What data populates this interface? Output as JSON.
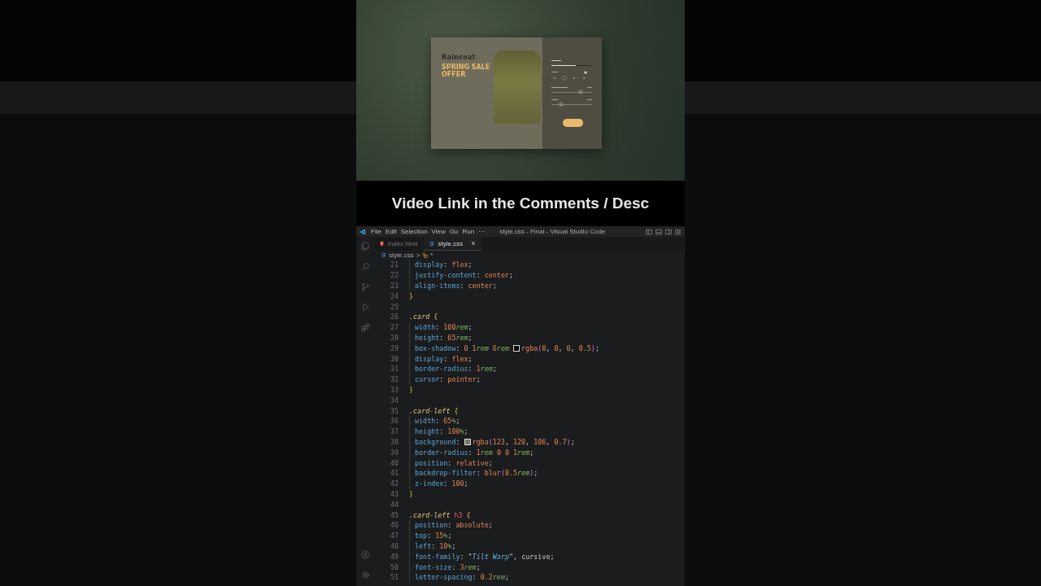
{
  "preview": {
    "card": {
      "eyebrow": "Raincoat",
      "headline": "SPRING SALE OFFER"
    }
  },
  "caption": "Video Link in the Comments / Desc",
  "editor": {
    "menu": [
      "File",
      "Edit",
      "Selection",
      "View",
      "Go",
      "Run",
      "···"
    ],
    "title": "style.css - Final - Visual Studio Code",
    "tabs": [
      {
        "label": "index.html",
        "kind": "html",
        "selected": false
      },
      {
        "label": "style.css",
        "kind": "css",
        "selected": true,
        "close": "×"
      }
    ],
    "breadcrumb": {
      "file": "style.css",
      "separator": ">",
      "symbol": "*"
    },
    "lines": [
      {
        "number": "21",
        "kind": "decl",
        "tokens": [
          {
            "kind": "prop",
            "text": "display"
          },
          {
            "kind": "punct",
            "text": ": "
          },
          {
            "kind": "val",
            "text": "flex"
          },
          {
            "kind": "punct",
            "text": ";"
          }
        ]
      },
      {
        "number": "22",
        "kind": "decl",
        "tokens": [
          {
            "kind": "prop",
            "text": "justify-content"
          },
          {
            "kind": "punct",
            "text": ": "
          },
          {
            "kind": "val",
            "text": "center"
          },
          {
            "kind": "punct",
            "text": ";"
          }
        ]
      },
      {
        "number": "23",
        "kind": "decl",
        "tokens": [
          {
            "kind": "prop",
            "text": "align-items"
          },
          {
            "kind": "punct",
            "text": ": "
          },
          {
            "kind": "val",
            "text": "center"
          },
          {
            "kind": "punct",
            "text": ";"
          }
        ]
      },
      {
        "number": "24",
        "kind": "rule",
        "tokens": [
          {
            "kind": "brace",
            "text": "}"
          }
        ]
      },
      {
        "number": "25",
        "kind": "blank"
      },
      {
        "number": "26",
        "kind": "rule",
        "tokens": [
          {
            "kind": "sel",
            "text": ".card "
          },
          {
            "kind": "brace",
            "text": "{"
          }
        ]
      },
      {
        "number": "27",
        "kind": "decl",
        "tokens": [
          {
            "kind": "prop",
            "text": "width"
          },
          {
            "kind": "punct",
            "text": ": "
          },
          {
            "kind": "val",
            "text": "100"
          },
          {
            "kind": "unit",
            "text": "rem"
          },
          {
            "kind": "punct",
            "text": ";"
          }
        ]
      },
      {
        "number": "28",
        "kind": "decl",
        "tokens": [
          {
            "kind": "prop",
            "text": "height"
          },
          {
            "kind": "punct",
            "text": ": "
          },
          {
            "kind": "val",
            "text": "65"
          },
          {
            "kind": "unit",
            "text": "rem"
          },
          {
            "kind": "punct",
            "text": ";"
          }
        ]
      },
      {
        "number": "29",
        "kind": "decl",
        "tokens": [
          {
            "kind": "prop",
            "text": "box-shadow"
          },
          {
            "kind": "punct",
            "text": ": "
          },
          {
            "kind": "val",
            "text": "0 1"
          },
          {
            "kind": "unit",
            "text": "rem"
          },
          {
            "kind": "val",
            "text": " 6"
          },
          {
            "kind": "unit",
            "text": "rem "
          },
          {
            "kind": "swatch",
            "color": "#000000"
          },
          {
            "kind": "val",
            "text": "rgba"
          },
          {
            "kind": "paren",
            "text": "("
          },
          {
            "kind": "val",
            "text": "0"
          },
          {
            "kind": "punct",
            "text": ", "
          },
          {
            "kind": "val",
            "text": "0"
          },
          {
            "kind": "punct",
            "text": ", "
          },
          {
            "kind": "val",
            "text": "0"
          },
          {
            "kind": "punct",
            "text": ", "
          },
          {
            "kind": "val",
            "text": "0.5"
          },
          {
            "kind": "paren",
            "text": ")"
          },
          {
            "kind": "punct",
            "text": ";"
          }
        ]
      },
      {
        "number": "30",
        "kind": "decl",
        "tokens": [
          {
            "kind": "prop",
            "text": "display"
          },
          {
            "kind": "punct",
            "text": ": "
          },
          {
            "kind": "val",
            "text": "flex"
          },
          {
            "kind": "punct",
            "text": ";"
          }
        ]
      },
      {
        "number": "31",
        "kind": "decl",
        "tokens": [
          {
            "kind": "prop",
            "text": "border-radius"
          },
          {
            "kind": "punct",
            "text": ": "
          },
          {
            "kind": "val",
            "text": "1"
          },
          {
            "kind": "unit",
            "text": "rem"
          },
          {
            "kind": "punct",
            "text": ";"
          }
        ]
      },
      {
        "number": "32",
        "kind": "decl",
        "tokens": [
          {
            "kind": "prop",
            "text": "cursor"
          },
          {
            "kind": "punct",
            "text": ": "
          },
          {
            "kind": "val",
            "text": "pointer"
          },
          {
            "kind": "punct",
            "text": ";"
          }
        ]
      },
      {
        "number": "33",
        "kind": "rule",
        "tokens": [
          {
            "kind": "brace",
            "text": "}"
          }
        ]
      },
      {
        "number": "34",
        "kind": "blank"
      },
      {
        "number": "35",
        "kind": "rule",
        "tokens": [
          {
            "kind": "sel",
            "text": ".card-left "
          },
          {
            "kind": "brace",
            "text": "{"
          }
        ]
      },
      {
        "number": "36",
        "kind": "decl",
        "tokens": [
          {
            "kind": "prop",
            "text": "width"
          },
          {
            "kind": "punct",
            "text": ": "
          },
          {
            "kind": "val",
            "text": "65"
          },
          {
            "kind": "unit",
            "text": "%"
          },
          {
            "kind": "punct",
            "text": ";"
          }
        ]
      },
      {
        "number": "37",
        "kind": "decl",
        "tokens": [
          {
            "kind": "prop",
            "text": "height"
          },
          {
            "kind": "punct",
            "text": ": "
          },
          {
            "kind": "val",
            "text": "100"
          },
          {
            "kind": "unit",
            "text": "%"
          },
          {
            "kind": "punct",
            "text": ";"
          }
        ]
      },
      {
        "number": "38",
        "kind": "decl",
        "tokens": [
          {
            "kind": "prop",
            "text": "background"
          },
          {
            "kind": "punct",
            "text": ": "
          },
          {
            "kind": "swatch",
            "color": "#7b786a"
          },
          {
            "kind": "val",
            "text": "rgba"
          },
          {
            "kind": "paren",
            "text": "("
          },
          {
            "kind": "val",
            "text": "123"
          },
          {
            "kind": "punct",
            "text": ", "
          },
          {
            "kind": "val",
            "text": "120"
          },
          {
            "kind": "punct",
            "text": ", "
          },
          {
            "kind": "val",
            "text": "106"
          },
          {
            "kind": "punct",
            "text": ", "
          },
          {
            "kind": "val",
            "text": "0.7"
          },
          {
            "kind": "paren",
            "text": ")"
          },
          {
            "kind": "punct",
            "text": ";"
          }
        ]
      },
      {
        "number": "39",
        "kind": "decl",
        "tokens": [
          {
            "kind": "prop",
            "text": "border-radius"
          },
          {
            "kind": "punct",
            "text": ": "
          },
          {
            "kind": "val",
            "text": "1"
          },
          {
            "kind": "unit",
            "text": "rem"
          },
          {
            "kind": "val",
            "text": " 0 0 1"
          },
          {
            "kind": "unit",
            "text": "rem"
          },
          {
            "kind": "punct",
            "text": ";"
          }
        ]
      },
      {
        "number": "40",
        "kind": "decl",
        "tokens": [
          {
            "kind": "prop",
            "text": "position"
          },
          {
            "kind": "punct",
            "text": ": "
          },
          {
            "kind": "val",
            "text": "relative"
          },
          {
            "kind": "punct",
            "text": ";"
          }
        ]
      },
      {
        "number": "41",
        "kind": "decl",
        "tokens": [
          {
            "kind": "prop",
            "text": "backdrop-filter"
          },
          {
            "kind": "punct",
            "text": ": "
          },
          {
            "kind": "val",
            "text": "blur"
          },
          {
            "kind": "paren",
            "text": "("
          },
          {
            "kind": "val",
            "text": "0.5"
          },
          {
            "kind": "unit",
            "text": "rem"
          },
          {
            "kind": "paren",
            "text": ")"
          },
          {
            "kind": "punct",
            "text": ";"
          }
        ]
      },
      {
        "number": "42",
        "kind": "decl",
        "tokens": [
          {
            "kind": "prop",
            "text": "z-index"
          },
          {
            "kind": "punct",
            "text": ": "
          },
          {
            "kind": "val",
            "text": "100"
          },
          {
            "kind": "punct",
            "text": ";"
          }
        ]
      },
      {
        "number": "43",
        "kind": "rule",
        "tokens": [
          {
            "kind": "brace",
            "text": "}"
          }
        ]
      },
      {
        "number": "44",
        "kind": "blank"
      },
      {
        "number": "45",
        "kind": "rule",
        "tokens": [
          {
            "kind": "sel",
            "text": ".card-left "
          },
          {
            "kind": "tag",
            "text": "h3"
          },
          {
            "kind": "brace",
            "text": " {"
          }
        ]
      },
      {
        "number": "46",
        "kind": "decl",
        "tokens": [
          {
            "kind": "prop",
            "text": "position"
          },
          {
            "kind": "punct",
            "text": ": "
          },
          {
            "kind": "val",
            "text": "absolute"
          },
          {
            "kind": "punct",
            "text": ";"
          }
        ]
      },
      {
        "number": "47",
        "kind": "decl",
        "tokens": [
          {
            "kind": "prop",
            "text": "top"
          },
          {
            "kind": "punct",
            "text": ": "
          },
          {
            "kind": "val",
            "text": "15"
          },
          {
            "kind": "unit",
            "text": "%"
          },
          {
            "kind": "punct",
            "text": ";"
          }
        ]
      },
      {
        "number": "48",
        "kind": "decl",
        "tokens": [
          {
            "kind": "prop",
            "text": "left"
          },
          {
            "kind": "punct",
            "text": ": "
          },
          {
            "kind": "val",
            "text": "10"
          },
          {
            "kind": "unit",
            "text": "%"
          },
          {
            "kind": "punct",
            "text": ";"
          }
        ]
      },
      {
        "number": "49",
        "kind": "decl",
        "tokens": [
          {
            "kind": "prop",
            "text": "font-family"
          },
          {
            "kind": "punct",
            "text": ": \""
          },
          {
            "kind": "str",
            "text": "Tilt Warp"
          },
          {
            "kind": "punct",
            "text": "\", cursive;"
          }
        ]
      },
      {
        "number": "50",
        "kind": "decl",
        "tokens": [
          {
            "kind": "prop",
            "text": "font-size"
          },
          {
            "kind": "punct",
            "text": ": "
          },
          {
            "kind": "val",
            "text": "3"
          },
          {
            "kind": "unit",
            "text": "rem"
          },
          {
            "kind": "punct",
            "text": ";"
          }
        ]
      },
      {
        "number": "51",
        "kind": "decl",
        "tokens": [
          {
            "kind": "prop",
            "text": "letter-spacing"
          },
          {
            "kind": "punct",
            "text": ": "
          },
          {
            "kind": "val",
            "text": "0.2"
          },
          {
            "kind": "unit",
            "text": "rem"
          },
          {
            "kind": "punct",
            "text": ";"
          }
        ]
      }
    ]
  }
}
